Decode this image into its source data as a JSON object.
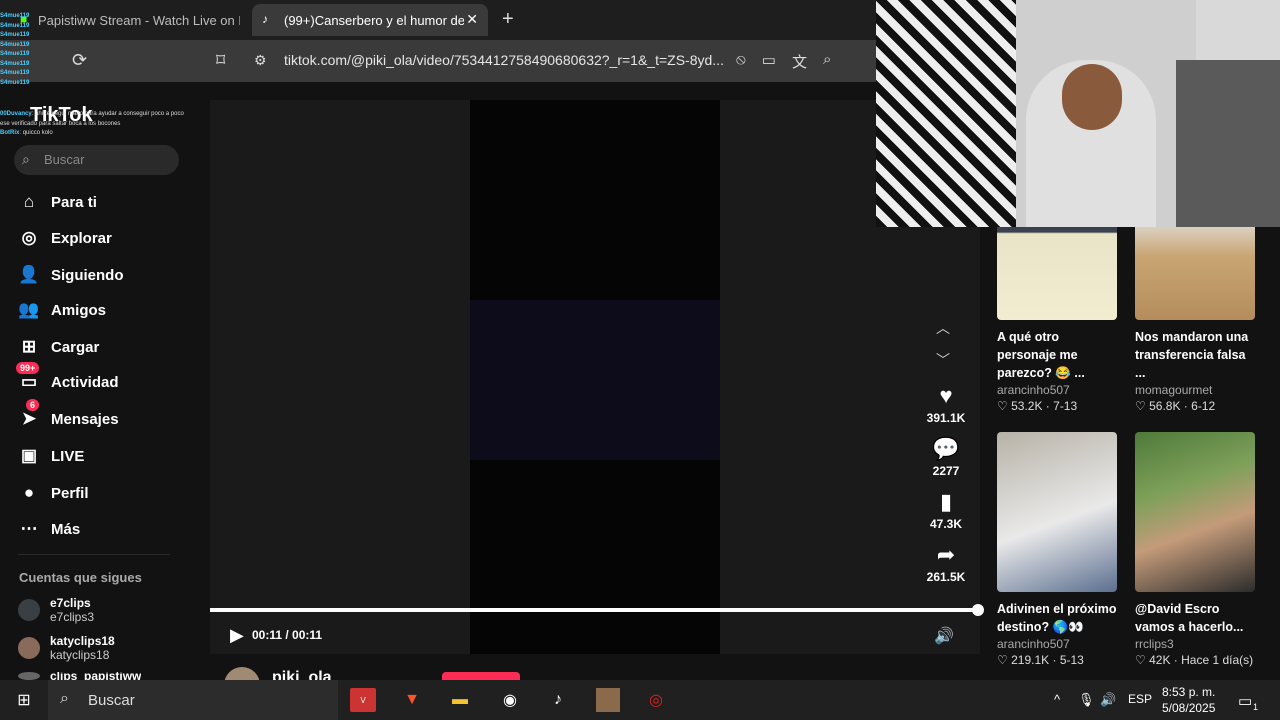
{
  "browser": {
    "tabs": [
      {
        "title": "Papistiww Stream - Watch Live on Ki",
        "active": false
      },
      {
        "title": "(99+)Canserbero y el humor de",
        "active": true
      }
    ],
    "url": "tiktok.com/@piki_ola/video/7534412758490680632?_r=1&_t=ZS-8yd..."
  },
  "sidebar": {
    "logo": "TikTok",
    "search_placeholder": "Buscar",
    "nav": [
      {
        "label": "Para ti",
        "icon": "home-icon"
      },
      {
        "label": "Explorar",
        "icon": "compass-icon"
      },
      {
        "label": "Siguiendo",
        "icon": "following-icon"
      },
      {
        "label": "Amigos",
        "icon": "friends-icon"
      },
      {
        "label": "Cargar",
        "icon": "upload-icon"
      },
      {
        "label": "Actividad",
        "icon": "activity-icon",
        "badge": "99+"
      },
      {
        "label": "Mensajes",
        "icon": "messages-icon",
        "badge": "6"
      },
      {
        "label": "LIVE",
        "icon": "live-icon"
      },
      {
        "label": "Perfil",
        "icon": "profile-icon"
      },
      {
        "label": "Más",
        "icon": "more-icon"
      }
    ],
    "following_title": "Cuentas que sigues",
    "following": [
      {
        "name": "e7clips",
        "handle": "e7clips3"
      },
      {
        "name": "katyclips18",
        "handle": "katyclips18"
      },
      {
        "name": "clips_papistiww",
        "handle": ""
      }
    ]
  },
  "player": {
    "time": "00:11 / 00:11",
    "progress": 1.0,
    "author": "piki_ola",
    "actions": [
      {
        "icon": "heart-icon",
        "count": "391.1K"
      },
      {
        "icon": "comment-icon",
        "count": "2277"
      },
      {
        "icon": "bookmark-icon",
        "count": "47.3K"
      },
      {
        "icon": "share-icon",
        "count": "261.5K"
      }
    ]
  },
  "recommendations": [
    {
      "title": "A qué otro personaje me parezco? 😂 ...",
      "user": "arancinho507",
      "likes": "53.2K",
      "date": "7-13"
    },
    {
      "title": "Nos mandaron una transferencia falsa ...",
      "user": "momagourmet",
      "likes": "56.8K",
      "date": "6-12"
    },
    {
      "title": "Adivinen el próximo destino? 🌎👀",
      "user": "arancinho507",
      "likes": "219.1K",
      "date": "5-13"
    },
    {
      "title": "@David Escro vamos a hacerlo...",
      "user": "rrclips3",
      "likes": "42K",
      "date": "Hace 1 día(s)"
    }
  ],
  "chat": [
    {
      "user": "S4mue119",
      "msg": ""
    },
    {
      "user": "S4mue119",
      "msg": ""
    },
    {
      "user": "S4mue119",
      "msg": ""
    },
    {
      "user": "S4mue119",
      "msg": ""
    },
    {
      "user": "S4mue119",
      "msg": ""
    },
    {
      "user": "S4mue119",
      "msg": ""
    },
    {
      "user": "S4mue119",
      "msg": ""
    },
    {
      "user": "S4mue119",
      "msg": ""
    },
    {
      "user": "00Duvancy",
      "msg": "ahí te seguí mano para ayudar a conseguir poco a poco ese verificado para saltar boca a los bocones"
    },
    {
      "user": "BotRix",
      "msg": "quicco kolo"
    }
  ],
  "taskbar": {
    "search_placeholder": "Buscar",
    "lang": "ESP",
    "time": "8:53 p. m.",
    "date": "5/08/2025",
    "notifications": "1"
  }
}
